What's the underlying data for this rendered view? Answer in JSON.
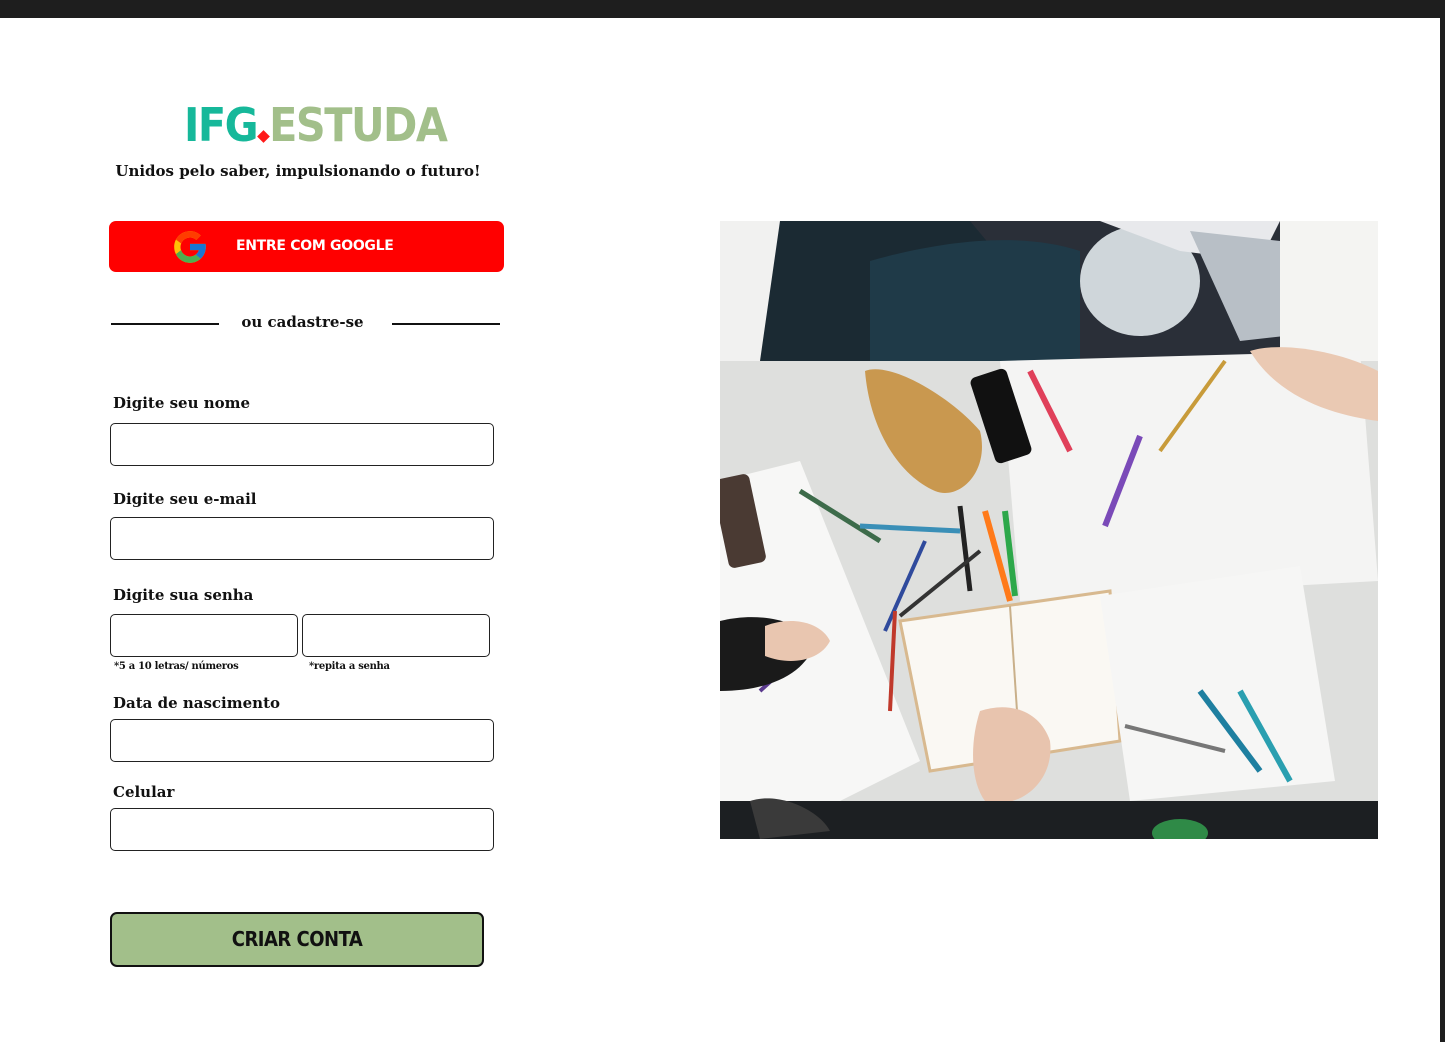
{
  "brand": {
    "part1": "IFG",
    "part2": "ESTUDA",
    "tagline": "Unidos pelo saber, impulsionando o futuro!"
  },
  "google": {
    "label": "ENTRE COM GOOGLE",
    "icon": "google-icon"
  },
  "divider": {
    "text": "ou cadastre-se"
  },
  "form": {
    "name_label": "Digite seu nome",
    "email_label": "Digite seu e-mail",
    "password_label": "Digite sua senha",
    "password_hint": "*5 a 10 letras/ números",
    "repeat_hint": "*repita a senha",
    "birth_label": "Data de nascimento",
    "phone_label": "Celular",
    "name_value": "",
    "email_value": "",
    "password_value": "",
    "repeat_value": "",
    "birth_value": "",
    "phone_value": ""
  },
  "submit": {
    "label": "CRIAR CONTA"
  },
  "colors": {
    "brand_teal": "#16b89a",
    "brand_green": "#a2bf8a",
    "google_red": "#ff0000",
    "dot_red": "#ff1a1a"
  },
  "image": {
    "subject": "students-studying-photo"
  }
}
